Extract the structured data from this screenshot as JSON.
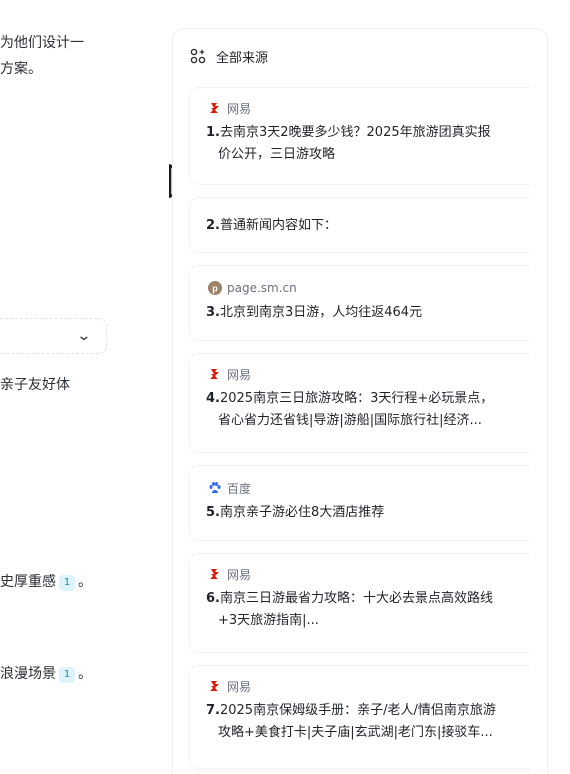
{
  "left_fragments": {
    "line1": "为他们设计一",
    "line2": "方案。",
    "line3": "亲子友好体",
    "line4": "史厚重感",
    "line5": "浪漫场景",
    "cite": "1",
    "period": "。"
  },
  "sources_panel": {
    "title": "全部来源",
    "items": [
      {
        "num": "1.",
        "source": "网易",
        "source_icon": "netease-logo-icon",
        "line1": "去南京3天2晚要多少钱？2025年旅游团真实报",
        "line2": "价公开，三日游攻略"
      },
      {
        "num": "2.",
        "source": "",
        "source_icon": "",
        "line1": "普通新闻内容如下：",
        "line2": ""
      },
      {
        "num": "3.",
        "source": "page.sm.cn",
        "source_icon": "p-circle-icon",
        "line1": "北京到南京3日游，人均往返464元",
        "line2": ""
      },
      {
        "num": "4.",
        "source": "网易",
        "source_icon": "netease-logo-icon",
        "line1": "2025南京三日旅游攻略：3天行程+必玩景点，",
        "line2": "省心省力还省钱|导游|游船|国际旅行社|经济..."
      },
      {
        "num": "5.",
        "source": "百度",
        "source_icon": "baidu-paw-icon",
        "line1": "南京亲子游必住8大酒店推荐",
        "line2": ""
      },
      {
        "num": "6.",
        "source": "网易",
        "source_icon": "netease-logo-icon",
        "line1": "南京三日游最省力攻略：十大必去景点高效路线",
        "line2": "+3天旅游指南|..."
      },
      {
        "num": "7.",
        "source": "网易",
        "source_icon": "netease-logo-icon",
        "line1": "2025南京保姆级手册：亲子/老人/情侣南京旅游",
        "line2": "攻略+美食打卡|夫子庙|玄武湖|老门东|接驳车..."
      }
    ]
  },
  "colors": {
    "netease": "#d81e06",
    "baidu": "#2f6bea",
    "cite_bg": "#def3fb",
    "cursor": "#c6f000"
  }
}
